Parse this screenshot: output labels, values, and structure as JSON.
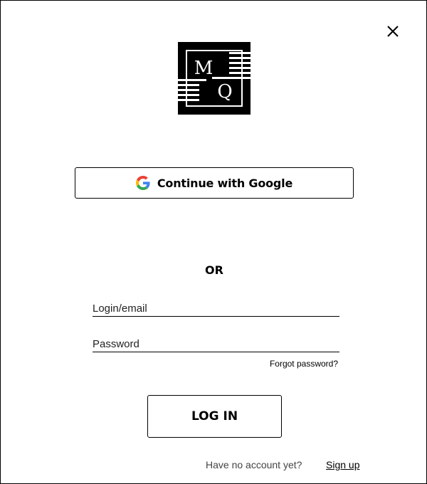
{
  "logo": {
    "letters": [
      "M",
      "Q"
    ]
  },
  "close": {
    "icon": "close-icon"
  },
  "google": {
    "label": "Continue with Google",
    "icon": "google-g-icon"
  },
  "divider": {
    "text": "OR"
  },
  "form": {
    "login_placeholder": "Login/email",
    "password_placeholder": "Password",
    "forgot_label": "Forgot password?",
    "submit_label": "LOG IN"
  },
  "signup": {
    "prompt": "Have no account yet?",
    "link_label": "Sign up"
  },
  "colors": {
    "google_blue": "#4285F4",
    "google_red": "#EA4335",
    "google_yellow": "#FBBC05",
    "google_green": "#34A853"
  }
}
